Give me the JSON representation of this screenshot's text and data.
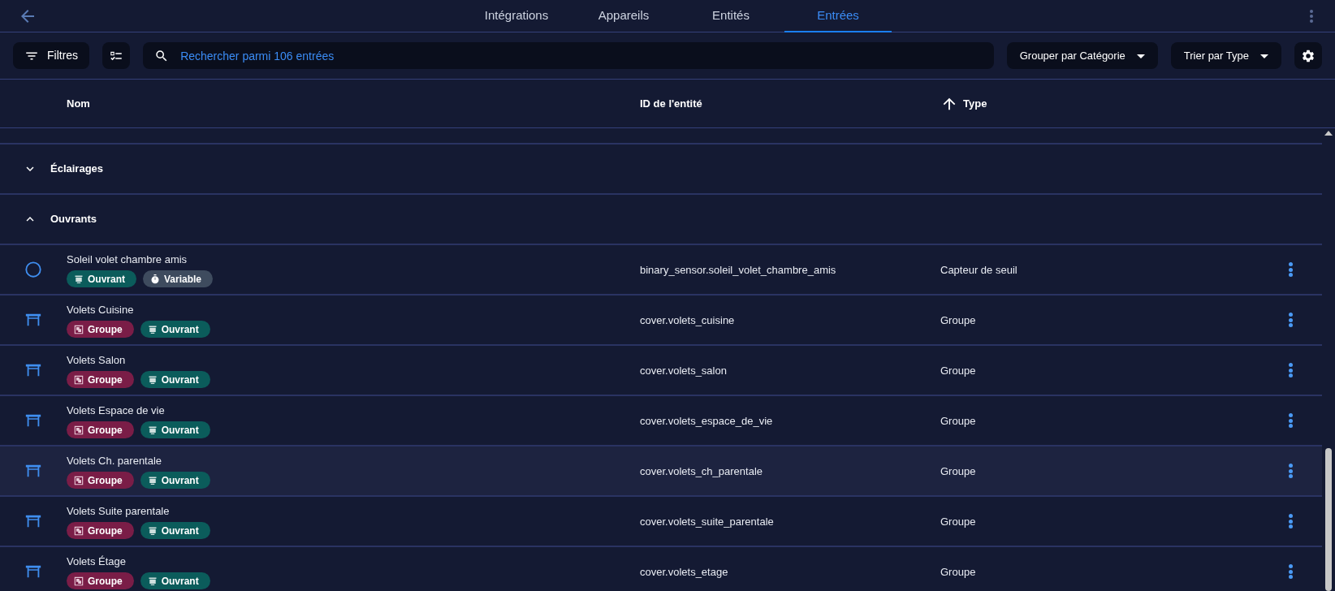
{
  "tabs": [
    {
      "label": "Intégrations",
      "selected": false
    },
    {
      "label": "Appareils",
      "selected": false
    },
    {
      "label": "Entités",
      "selected": false
    },
    {
      "label": "Entrées",
      "selected": true
    }
  ],
  "toolbar": {
    "filters_label": "Filtres",
    "search": {
      "placeholder": "Rechercher parmi 106 entrées"
    },
    "group_by": "Grouper par Catégorie",
    "sort_by": "Trier par Type"
  },
  "table": {
    "columns": [
      "Nom",
      "ID de l'entité",
      "Type"
    ],
    "groups": [
      {
        "label": "Éclairages",
        "expanded": false
      },
      {
        "label": "Ouvrants",
        "expanded": true,
        "rows": [
          {
            "kind": "circle",
            "name": "Soleil volet chambre amis",
            "tags": [
              {
                "kind": "shutter",
                "label": "Ouvrant",
                "color": "#0b5c5b"
              },
              {
                "kind": "timer",
                "label": "Variable",
                "color": "#3e4b5e"
              }
            ],
            "entity_id": "binary_sensor.soleil_volet_chambre_amis",
            "type": "Capteur de seuil",
            "hovered": false
          },
          {
            "kind": "shutter",
            "name": "Volets Cuisine",
            "tags": [
              {
                "kind": "group",
                "label": "Groupe",
                "color": "#7a1d47"
              },
              {
                "kind": "shutter",
                "label": "Ouvrant",
                "color": "#0b5c5b"
              }
            ],
            "entity_id": "cover.volets_cuisine",
            "type": "Groupe",
            "hovered": false
          },
          {
            "kind": "shutter",
            "name": "Volets Salon",
            "tags": [
              {
                "kind": "group",
                "label": "Groupe",
                "color": "#7a1d47"
              },
              {
                "kind": "shutter",
                "label": "Ouvrant",
                "color": "#0b5c5b"
              }
            ],
            "entity_id": "cover.volets_salon",
            "type": "Groupe",
            "hovered": false
          },
          {
            "kind": "shutter",
            "name": "Volets Espace de vie",
            "tags": [
              {
                "kind": "group",
                "label": "Groupe",
                "color": "#7a1d47"
              },
              {
                "kind": "shutter",
                "label": "Ouvrant",
                "color": "#0b5c5b"
              }
            ],
            "entity_id": "cover.volets_espace_de_vie",
            "type": "Groupe",
            "hovered": false
          },
          {
            "kind": "shutter",
            "name": "Volets Ch. parentale",
            "tags": [
              {
                "kind": "group",
                "label": "Groupe",
                "color": "#7a1d47"
              },
              {
                "kind": "shutter",
                "label": "Ouvrant",
                "color": "#0b5c5b"
              }
            ],
            "entity_id": "cover.volets_ch_parentale",
            "type": "Groupe",
            "hovered": true
          },
          {
            "kind": "shutter",
            "name": "Volets Suite parentale",
            "tags": [
              {
                "kind": "group",
                "label": "Groupe",
                "color": "#7a1d47"
              },
              {
                "kind": "shutter",
                "label": "Ouvrant",
                "color": "#0b5c5b"
              }
            ],
            "entity_id": "cover.volets_suite_parentale",
            "type": "Groupe",
            "hovered": false
          },
          {
            "kind": "shutter",
            "name": "Volets Étage",
            "tags": [
              {
                "kind": "group",
                "label": "Groupe",
                "color": "#7a1d47"
              },
              {
                "kind": "shutter",
                "label": "Ouvrant",
                "color": "#0b5c5b"
              }
            ],
            "entity_id": "cover.volets_etage",
            "type": "Groupe",
            "hovered": false
          }
        ]
      }
    ]
  }
}
